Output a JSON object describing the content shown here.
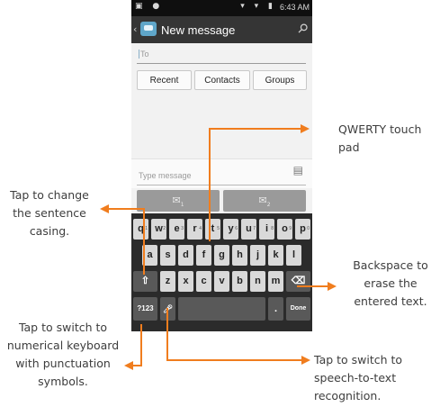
{
  "status_bar": {
    "left_icons": "▣ ●",
    "right_icons": "▾ ▾ ▮",
    "time": "6:43 AM"
  },
  "action_bar": {
    "back_glyph": "‹",
    "title": "New message",
    "attach_icon": "paperclip-icon"
  },
  "to_field": {
    "placeholder": "To"
  },
  "recipient_buttons": [
    "Recent",
    "Contacts",
    "Groups"
  ],
  "compose": {
    "placeholder": "Type message"
  },
  "send_buttons": [
    {
      "icon": "envelope-icon",
      "sim": "1"
    },
    {
      "icon": "envelope-icon",
      "sim": "2"
    }
  ],
  "keyboard": {
    "row1": [
      "q",
      "w",
      "e",
      "r",
      "t",
      "y",
      "u",
      "i",
      "o",
      "p"
    ],
    "row1_nums": [
      "1",
      "2",
      "3",
      "4",
      "5",
      "6",
      "7",
      "8",
      "9",
      "0"
    ],
    "row2": [
      "a",
      "s",
      "d",
      "f",
      "g",
      "h",
      "j",
      "k",
      "l"
    ],
    "row3": [
      "z",
      "x",
      "c",
      "v",
      "b",
      "n",
      "m"
    ],
    "shift": "⇧",
    "backspace": "⌫",
    "symbols": "?123",
    "mic": "🎤",
    "period": ".",
    "done": "Done"
  },
  "callouts": {
    "qwerty": "QWERTY touch pad",
    "casing": "Tap to change the sentence casing.",
    "backspace": "Backspace to erase the entered text.",
    "numeric": "Tap to switch to numerical keyboard with punctuation symbols.",
    "speech": "Tap to switch to speech-to-text recognition."
  },
  "colors": {
    "arrow": "#f07d1e",
    "action_bar": "#353535",
    "keyboard_bg": "#2b2b2b"
  }
}
